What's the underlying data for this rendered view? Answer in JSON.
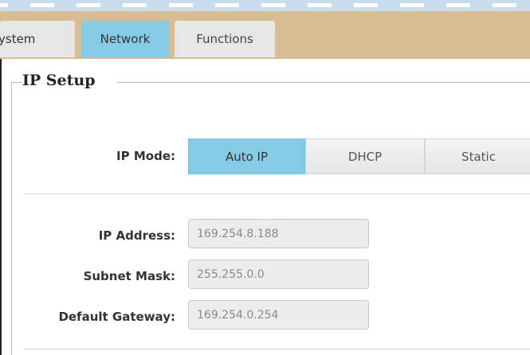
{
  "tabs": [
    {
      "label": "ystem"
    },
    {
      "label": "Network"
    },
    {
      "label": "Functions"
    }
  ],
  "section": {
    "title": "IP Setup"
  },
  "ip_mode": {
    "label": "IP Mode:",
    "options": [
      "Auto IP",
      "DHCP",
      "Static"
    ],
    "selected": "Auto IP"
  },
  "fields": {
    "ip_address": {
      "label": "IP Address:",
      "value": "169.254.8.188"
    },
    "subnet_mask": {
      "label": "Subnet Mask:",
      "value": "255.255.0.0"
    },
    "default_gateway": {
      "label": "Default Gateway:",
      "value": "169.254.0.254"
    }
  },
  "colors": {
    "tab_bar": "#d7bd91",
    "active": "#86cbe6",
    "inactive_tab": "#e6e6e6"
  }
}
